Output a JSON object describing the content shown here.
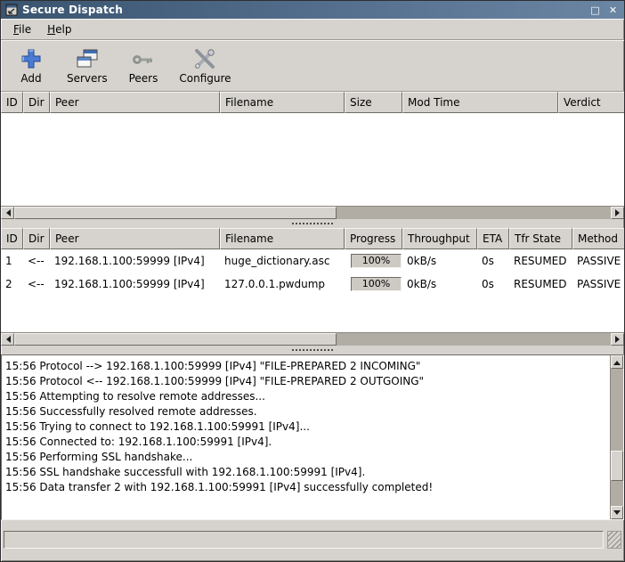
{
  "window": {
    "title": "Secure Dispatch",
    "maximize_glyph": "□",
    "close_glyph": "✕"
  },
  "menu": {
    "file": "File",
    "help": "Help"
  },
  "toolbar": {
    "add": "Add",
    "servers": "Servers",
    "peers": "Peers",
    "configure": "Configure"
  },
  "pending_table": {
    "columns": [
      "ID",
      "Dir",
      "Peer",
      "Filename",
      "Size",
      "Mod Time",
      "Verdict"
    ],
    "rows": []
  },
  "transfers_table": {
    "columns": [
      "ID",
      "Dir",
      "Peer",
      "Filename",
      "Progress",
      "Throughput",
      "ETA",
      "Tfr State",
      "Method"
    ],
    "rows": [
      {
        "id": "1",
        "dir": "<--",
        "peer": "192.168.1.100:59999 [IPv4]",
        "filename": "huge_dictionary.asc",
        "progress": "100%",
        "throughput": "0kB/s",
        "eta": "0s",
        "tfr_state": "RESUMED",
        "method": "PASSIVE"
      },
      {
        "id": "2",
        "dir": "<--",
        "peer": "192.168.1.100:59999 [IPv4]",
        "filename": "127.0.0.1.pwdump",
        "progress": "100%",
        "throughput": "0kB/s",
        "eta": "0s",
        "tfr_state": "RESUMED",
        "method": "PASSIVE"
      }
    ]
  },
  "log": {
    "lines": [
      "15:56 Protocol --> 192.168.1.100:59999 [IPv4] \"FILE-PREPARED 2 INCOMING\"",
      "15:56 Protocol <-- 192.168.1.100:59999 [IPv4] \"FILE-PREPARED 2 OUTGOING\"",
      "15:56 Attempting to resolve remote addresses...",
      "15:56 Successfully resolved remote addresses.",
      "15:56 Trying to connect to 192.168.1.100:59991 [IPv4]...",
      "15:56 Connected to: 192.168.1.100:59991 [IPv4].",
      "15:56 Performing SSL handshake...",
      "15:56 SSL handshake successfull with 192.168.1.100:59991 [IPv4].",
      "15:56 Data transfer 2 with 192.168.1.100:59991 [IPv4] successfully completed!"
    ]
  },
  "colors": {
    "background": "#d6d3ce",
    "titlebar": "#54708e",
    "accent_blue": "#4a7ad4"
  }
}
